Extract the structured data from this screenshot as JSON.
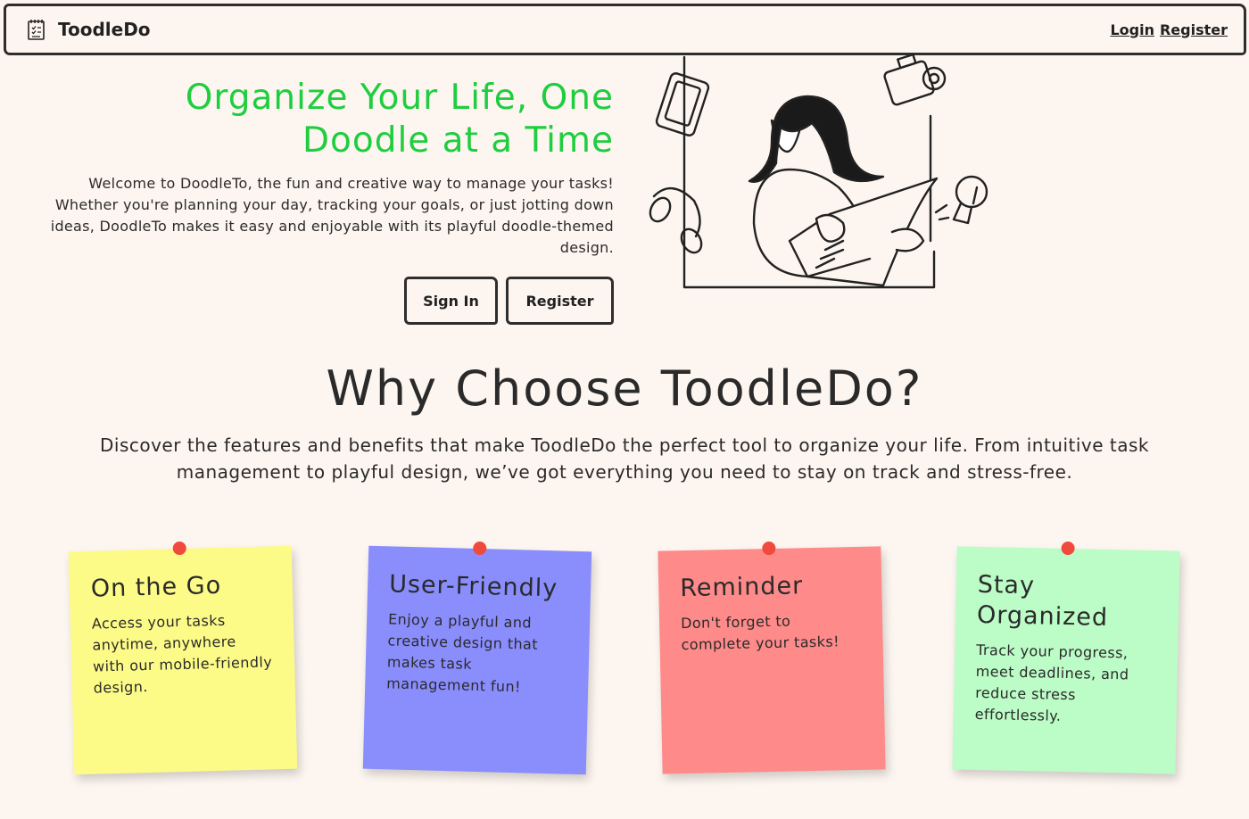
{
  "nav": {
    "brand": "ToodleDo",
    "login": "Login",
    "register": "Register"
  },
  "hero": {
    "title_line1": "Organize Your Life, One",
    "title_line2": "Doodle at a Time",
    "description": "Welcome to DoodleTo, the fun and creative way to manage your tasks! Whether you're planning your day, tracking your goals, or just jotting down ideas, DoodleTo makes it easy and enjoyable with its playful doodle-themed design.",
    "signin_label": "Sign In",
    "register_label": "Register",
    "title_color": "#1fce3f"
  },
  "why": {
    "title": "Why Choose ToodleDo?",
    "description": "Discover the features and benefits that make ToodleDo the perfect tool to organize your life. From intuitive task management to playful design, we’ve got everything you need to stay on track and stress-free."
  },
  "features": [
    {
      "title": "On the Go",
      "text": "Access your tasks anytime, anywhere with our mobile-friendly design.",
      "color": "#fdfb88"
    },
    {
      "title": "User-Friendly",
      "text": "Enjoy a playful and creative design that makes task management fun!",
      "color": "#8a8dfc"
    },
    {
      "title": "Reminder",
      "text": "Don't forget to complete your tasks!",
      "color": "#fe8a8a"
    },
    {
      "title": "Stay Organized",
      "text": "Track your progress, meet deadlines, and reduce stress effortlessly.",
      "color": "#bcfcc6"
    }
  ],
  "colors": {
    "background": "#fdf6f0",
    "pin": "#ef4a3b"
  }
}
